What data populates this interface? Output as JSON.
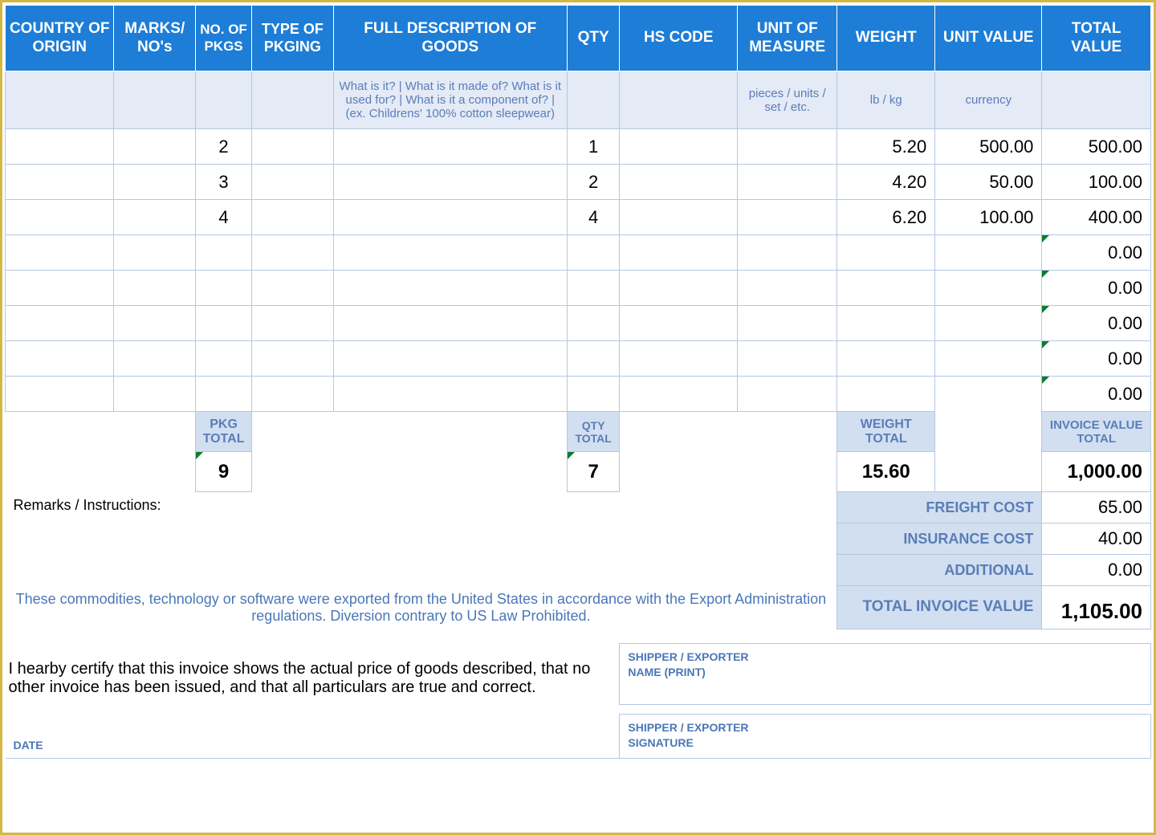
{
  "headers": {
    "country": "COUNTRY OF ORIGIN",
    "marks": "MARKS/ NO's",
    "pkgs": "NO. OF PKGS",
    "pkging": "TYPE OF PKGING",
    "desc": "FULL DESCRIPTION OF GOODS",
    "qty": "QTY",
    "hs": "HS CODE",
    "uom": "UNIT OF MEASURE",
    "weight": "WEIGHT",
    "uvalue": "UNIT VALUE",
    "tvalue": "TOTAL VALUE"
  },
  "hints": {
    "desc": "What is it? | What is it made of? What is it used for? | What is it a component of? | (ex. Childrens' 100% cotton sleepwear)",
    "uom": "pieces / units / set / etc.",
    "weight": "lb / kg",
    "uvalue": "currency"
  },
  "rows": [
    {
      "pkgs": "2",
      "qty": "1",
      "weight": "5.20",
      "uvalue": "500.00",
      "tvalue": "500.00"
    },
    {
      "pkgs": "3",
      "qty": "2",
      "weight": "4.20",
      "uvalue": "50.00",
      "tvalue": "100.00"
    },
    {
      "pkgs": "4",
      "qty": "4",
      "weight": "6.20",
      "uvalue": "100.00",
      "tvalue": "400.00"
    }
  ],
  "zero": "0.00",
  "totals": {
    "pkg_label": "PKG TOTAL",
    "qty_label": "QTY TOTAL",
    "weight_label": "WEIGHT TOTAL",
    "invoice_label": "INVOICE VALUE TOTAL",
    "pkg": "9",
    "qty": "7",
    "weight": "15.60",
    "invoice": "1,000.00"
  },
  "remarks_label": "Remarks / Instructions:",
  "costs": {
    "freight_label": "FREIGHT COST",
    "freight": "65.00",
    "insurance_label": "INSURANCE COST",
    "insurance": "40.00",
    "additional_label": "ADDITIONAL",
    "additional": "0.00",
    "total_label": "TOTAL INVOICE VALUE",
    "total": "1,105.00"
  },
  "export_note": "These commodities, technology or software were exported from the United States in accordance with the Export Administration regulations.  Diversion contrary to US Law Prohibited.",
  "cert": "I hearby certify that this invoice shows the actual price of goods described, that no other invoice has been issued, and that all particulars are true and correct.",
  "sig": {
    "name1": "SHIPPER / EXPORTER",
    "name2": "NAME (PRINT)",
    "sig1": "SHIPPER / EXPORTER",
    "sig2": "SIGNATURE",
    "date": "DATE"
  }
}
